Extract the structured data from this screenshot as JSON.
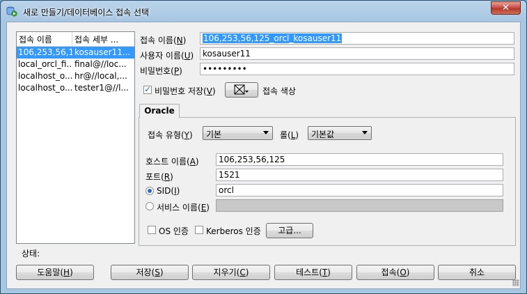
{
  "window": {
    "title": "새로 만들기/데이터베이스 접속 선택",
    "close_label": "✕"
  },
  "connection_list": {
    "columns": [
      "접속 이름",
      "접속 세부 ..."
    ],
    "rows": [
      {
        "name": "106,253,56,1...",
        "detail": "kosauser11...",
        "selected": true
      },
      {
        "name": "local_orcl_fi...",
        "detail": "final@//loc...",
        "selected": false
      },
      {
        "name": "localhost_o...",
        "detail": "hr@//local,...",
        "selected": false
      },
      {
        "name": "localhost_o...",
        "detail": "tester1@//l...",
        "selected": false
      }
    ]
  },
  "form": {
    "connection_name": {
      "label": "접속 이름(",
      "key": "N",
      "value": "106,253,56,125_orcl_kosauser11"
    },
    "username": {
      "label": "사용자 이름(",
      "key": "U",
      "value": "kosauser11"
    },
    "password": {
      "label": "비밀번호(",
      "key": "P",
      "value": "•••••••••"
    },
    "save_password": {
      "label": "비밀번호 저장(",
      "key": "V",
      "checked": true
    },
    "connection_color": {
      "label": "접속 색상"
    }
  },
  "oracle_tab": {
    "tab_label": "Oracle",
    "connection_type": {
      "label": "접속 유형(",
      "key": "Y",
      "value": "기본"
    },
    "role": {
      "label": "롤(",
      "key": "L",
      "value": "기본값"
    },
    "hostname": {
      "label": "호스트 이름(",
      "key": "A",
      "value": "106,253,56,125"
    },
    "port": {
      "label": "포트(",
      "key": "R",
      "value": "1521"
    },
    "sid": {
      "label": "SID(",
      "key": "I",
      "value": "orcl",
      "selected": true
    },
    "service_name": {
      "label": "서비스 이름(",
      "key": "E",
      "value": "",
      "selected": false
    },
    "os_auth": {
      "label": "OS 인증",
      "checked": false
    },
    "kerberos_auth": {
      "label": "Kerberos 인증",
      "checked": false
    },
    "advanced_button": "고급..."
  },
  "status": {
    "label": "상태:"
  },
  "buttons": {
    "help": {
      "label": "도움말(",
      "key": "H"
    },
    "save": {
      "label": "저장(",
      "key": "S"
    },
    "clear": {
      "label": "지우기(",
      "key": "C"
    },
    "test": {
      "label": "테스트(",
      "key": "T"
    },
    "connect": {
      "label": "접속(",
      "key": "O"
    },
    "cancel": {
      "label": "취소"
    }
  }
}
